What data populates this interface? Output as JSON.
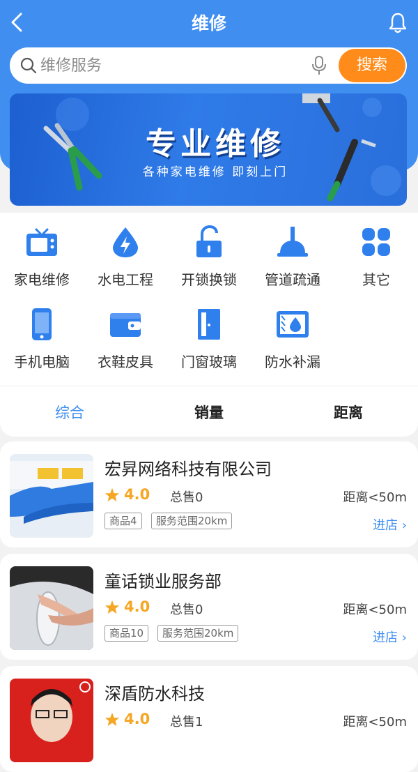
{
  "colors": {
    "primary": "#3f8ef0",
    "accent": "#ff8c1a",
    "star": "#f5a623"
  },
  "nav": {
    "title": "维修",
    "back_icon": "chevron-left-icon",
    "bell_icon": "bell-icon"
  },
  "search": {
    "placeholder": "维修服务",
    "button_label": "搜索"
  },
  "banner": {
    "title": "专业维修",
    "subtitle": "各种家电维修 即刻上门"
  },
  "categories": [
    {
      "label": "家电维修",
      "icon": "tv-icon"
    },
    {
      "label": "水电工程",
      "icon": "water-drop-icon"
    },
    {
      "label": "开锁换锁",
      "icon": "unlock-icon"
    },
    {
      "label": "管道疏通",
      "icon": "plunger-icon"
    },
    {
      "label": "其它",
      "icon": "grid-icon"
    },
    {
      "label": "手机电脑",
      "icon": "phone-icon"
    },
    {
      "label": "衣鞋皮具",
      "icon": "wallet-icon"
    },
    {
      "label": "门窗玻璃",
      "icon": "door-icon"
    },
    {
      "label": "防水补漏",
      "icon": "waterproof-icon"
    }
  ],
  "sort": {
    "tabs": [
      "综合",
      "销量",
      "距离"
    ],
    "active": "综合"
  },
  "shops": [
    {
      "name": "宏昇网络科技有限公司",
      "rating": "4.0",
      "sold": "总售0",
      "distance": "距离<50m",
      "tags": [
        "商品4",
        "服务范围20km"
      ],
      "enter": "进店"
    },
    {
      "name": "童话锁业服务部",
      "rating": "4.0",
      "sold": "总售0",
      "distance": "距离<50m",
      "tags": [
        "商品10",
        "服务范围20km"
      ],
      "enter": "进店"
    },
    {
      "name": "深盾防水科技",
      "rating": "4.0",
      "sold": "总售1",
      "distance": "距离<50m",
      "tags": [],
      "enter": ""
    }
  ]
}
